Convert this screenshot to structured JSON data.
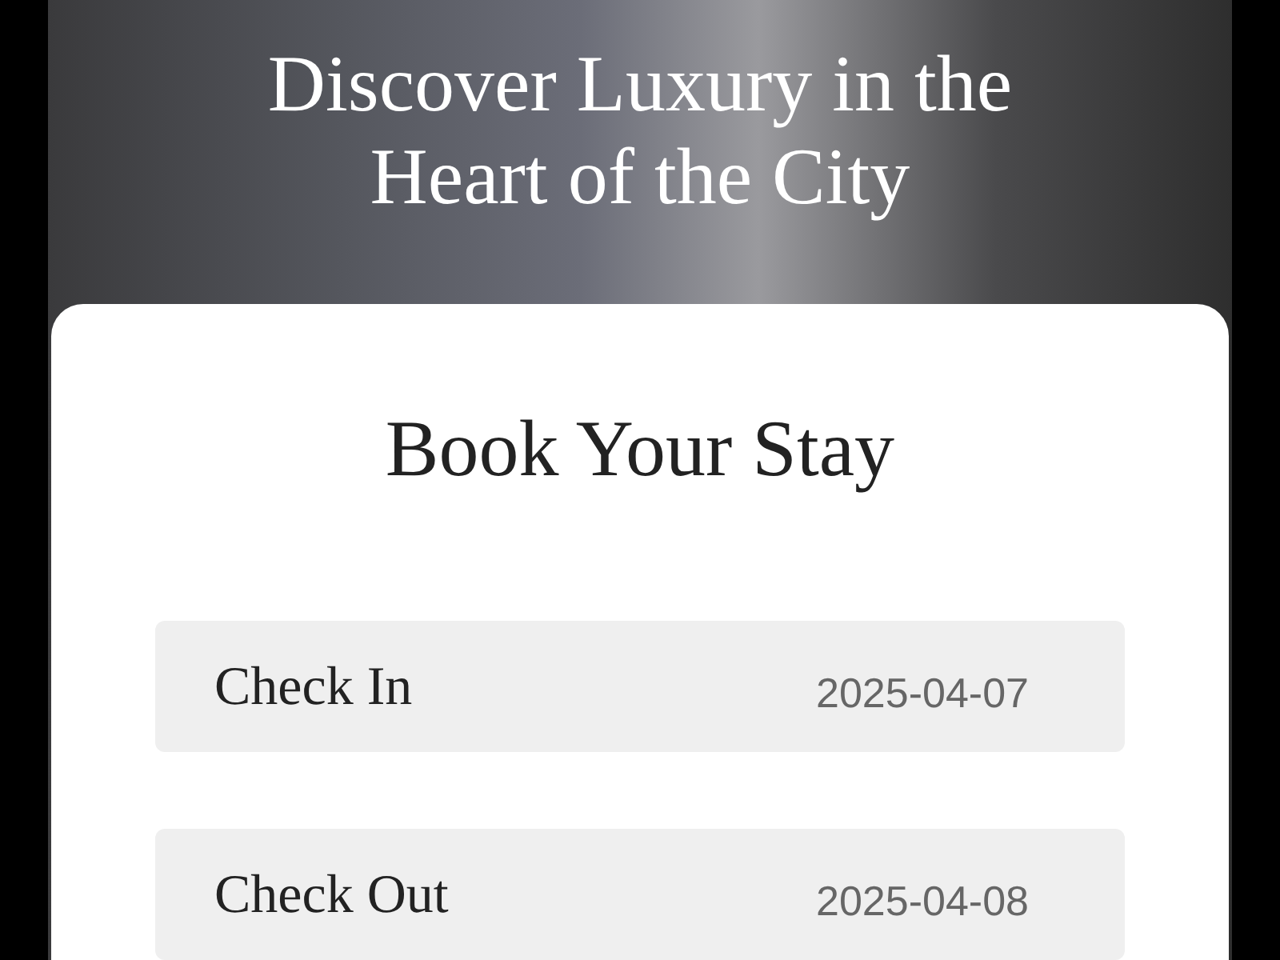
{
  "hero": {
    "title_lines": [
      "Discover Luxury in the",
      "Heart of the City"
    ]
  },
  "booking": {
    "title": "Book Your Stay",
    "fields": [
      {
        "label": "Check In",
        "value": "2025-04-07"
      },
      {
        "label": "Check Out",
        "value": "2025-04-08"
      }
    ]
  }
}
